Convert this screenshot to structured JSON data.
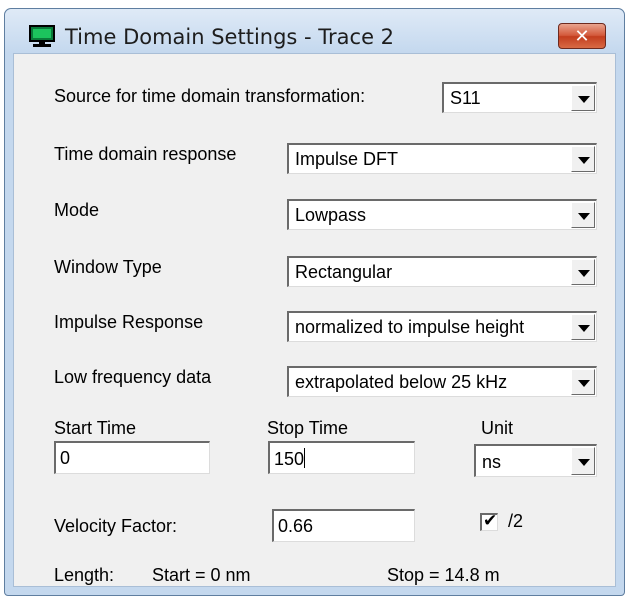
{
  "window": {
    "title": "Time Domain Settings - Trace 2",
    "close_glyph": "✕",
    "app_icon": "monitor-icon"
  },
  "source": {
    "label": "Source for time domain transformation:",
    "value": "S11"
  },
  "response": {
    "label": "Time domain response",
    "value": "Impulse DFT"
  },
  "mode": {
    "label": "Mode",
    "value": "Lowpass"
  },
  "window_type": {
    "label": "Window Type",
    "value": "Rectangular"
  },
  "impulse": {
    "label": "Impulse Response",
    "value": "normalized to impulse height"
  },
  "low_freq": {
    "label": "Low frequency data",
    "value": "extrapolated below 25 kHz"
  },
  "start_time": {
    "label": "Start Time",
    "value": "0"
  },
  "stop_time": {
    "label": "Stop Time",
    "value": "150"
  },
  "unit": {
    "label": "Unit",
    "value": "ns"
  },
  "velocity": {
    "label": "Velocity Factor:",
    "value": "0.66"
  },
  "halve": {
    "checked": true,
    "check_glyph": "✔",
    "label": "/2"
  },
  "length": {
    "label": "Length:",
    "start": "Start = 0 nm",
    "stop": "Stop = 14.8 m"
  },
  "colors": {
    "title_bar": "#c4d8ee",
    "close_button": "#c9452a",
    "dialog_bg": "#f0f0f0"
  }
}
